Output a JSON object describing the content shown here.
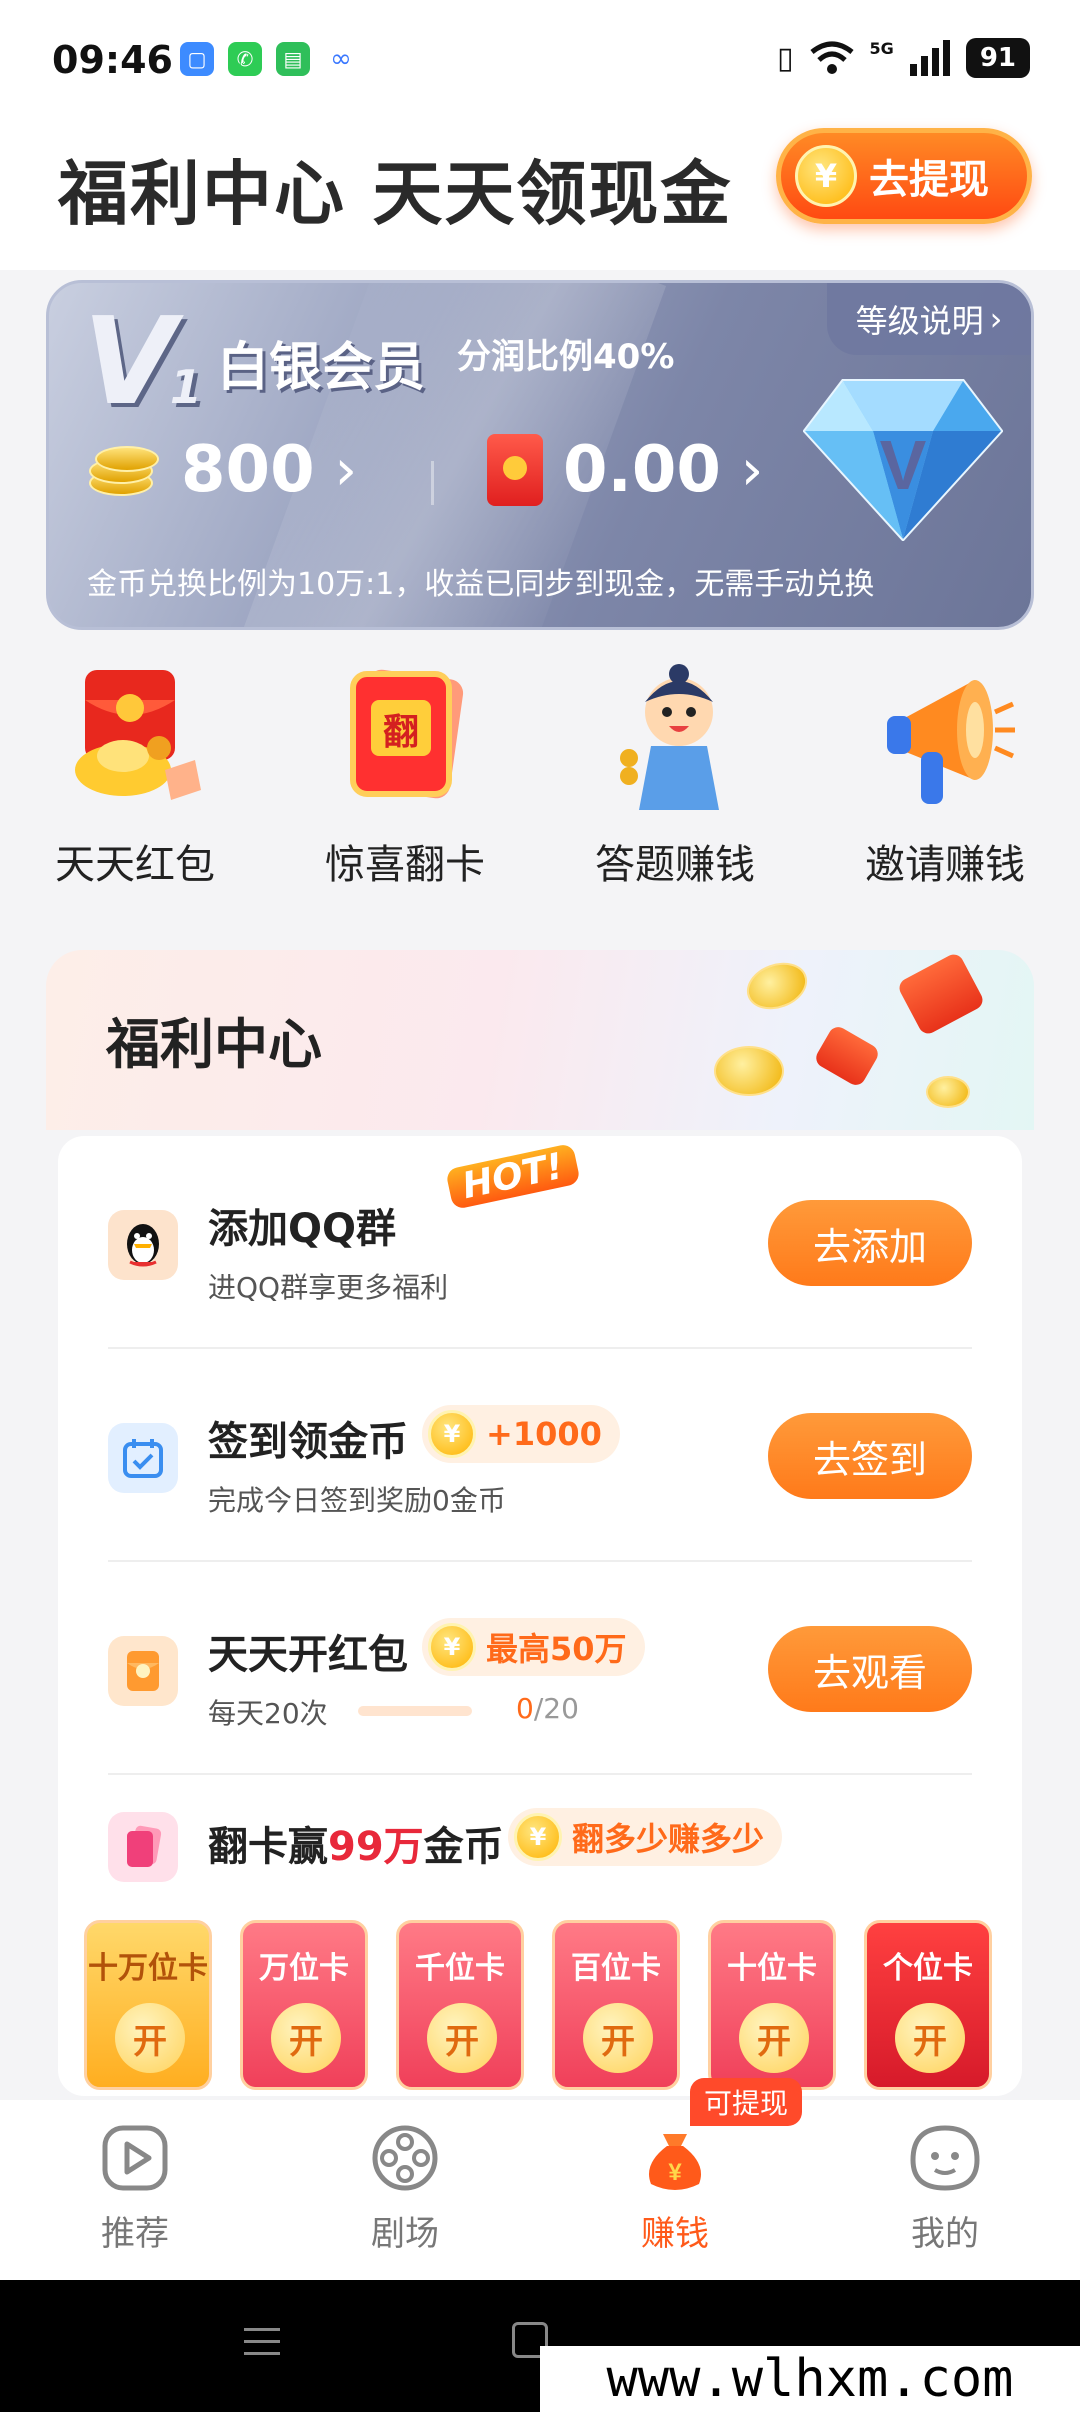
{
  "status_bar": {
    "time": "09:46",
    "network": "5G",
    "battery": "91",
    "icons": [
      "vibrate-icon",
      "wifi-icon",
      "signal-icon"
    ]
  },
  "header": {
    "title": "福利中心 天天领现金",
    "withdraw_label": "去提现",
    "coin_symbol": "¥"
  },
  "vip": {
    "badge": "V",
    "badge_num": "1",
    "level": "白银会员",
    "ratio": "分润比例40%",
    "level_desc": "等级说明",
    "coins": "800",
    "cash": "0.00",
    "note": "金币兑换比例为10万:1，收益已同步到现金，无需手动兑换"
  },
  "shortcuts": [
    {
      "label": "天天红包",
      "icon": "red-envelope-icon"
    },
    {
      "label": "惊喜翻卡",
      "icon": "flip-card-icon"
    },
    {
      "label": "答题赚钱",
      "icon": "quiz-character-icon"
    },
    {
      "label": "邀请赚钱",
      "icon": "megaphone-icon"
    }
  ],
  "welfare": {
    "title": "福利中心",
    "tasks": [
      {
        "title": "添加QQ群",
        "hot": "HOT!",
        "sub": "进QQ群享更多福利",
        "button": "去添加",
        "icon": "qq-icon"
      },
      {
        "title": "签到领金币",
        "badge": "+1000",
        "sub": "完成今日签到奖励0金币",
        "button": "去签到",
        "icon": "calendar-icon"
      },
      {
        "title": "天天开红包",
        "badge": "最高50万",
        "sub": "每天20次",
        "progress_done": "0",
        "progress_total": "/20",
        "progress": 0,
        "button": "去观看",
        "icon": "red-packet-icon"
      }
    ],
    "flip": {
      "title_pre": "翻卡赢",
      "title_hl": "99万",
      "title_post": "金币",
      "badge": "翻多少赚多少",
      "cards": [
        "十万位卡",
        "万位卡",
        "千位卡",
        "百位卡",
        "十位卡",
        "个位卡"
      ],
      "open_label": "开"
    }
  },
  "bottom_nav": {
    "items": [
      {
        "label": "推荐",
        "icon": "play-icon"
      },
      {
        "label": "剧场",
        "icon": "film-reel-icon"
      },
      {
        "label": "赚钱",
        "icon": "money-bag-icon",
        "badge": "可提现"
      },
      {
        "label": "我的",
        "icon": "profile-face-icon"
      }
    ]
  },
  "watermark": "www.wlhxm.com",
  "colors": {
    "accent": "#ff7a1a",
    "red": "#e8283a",
    "text": "#222222"
  }
}
